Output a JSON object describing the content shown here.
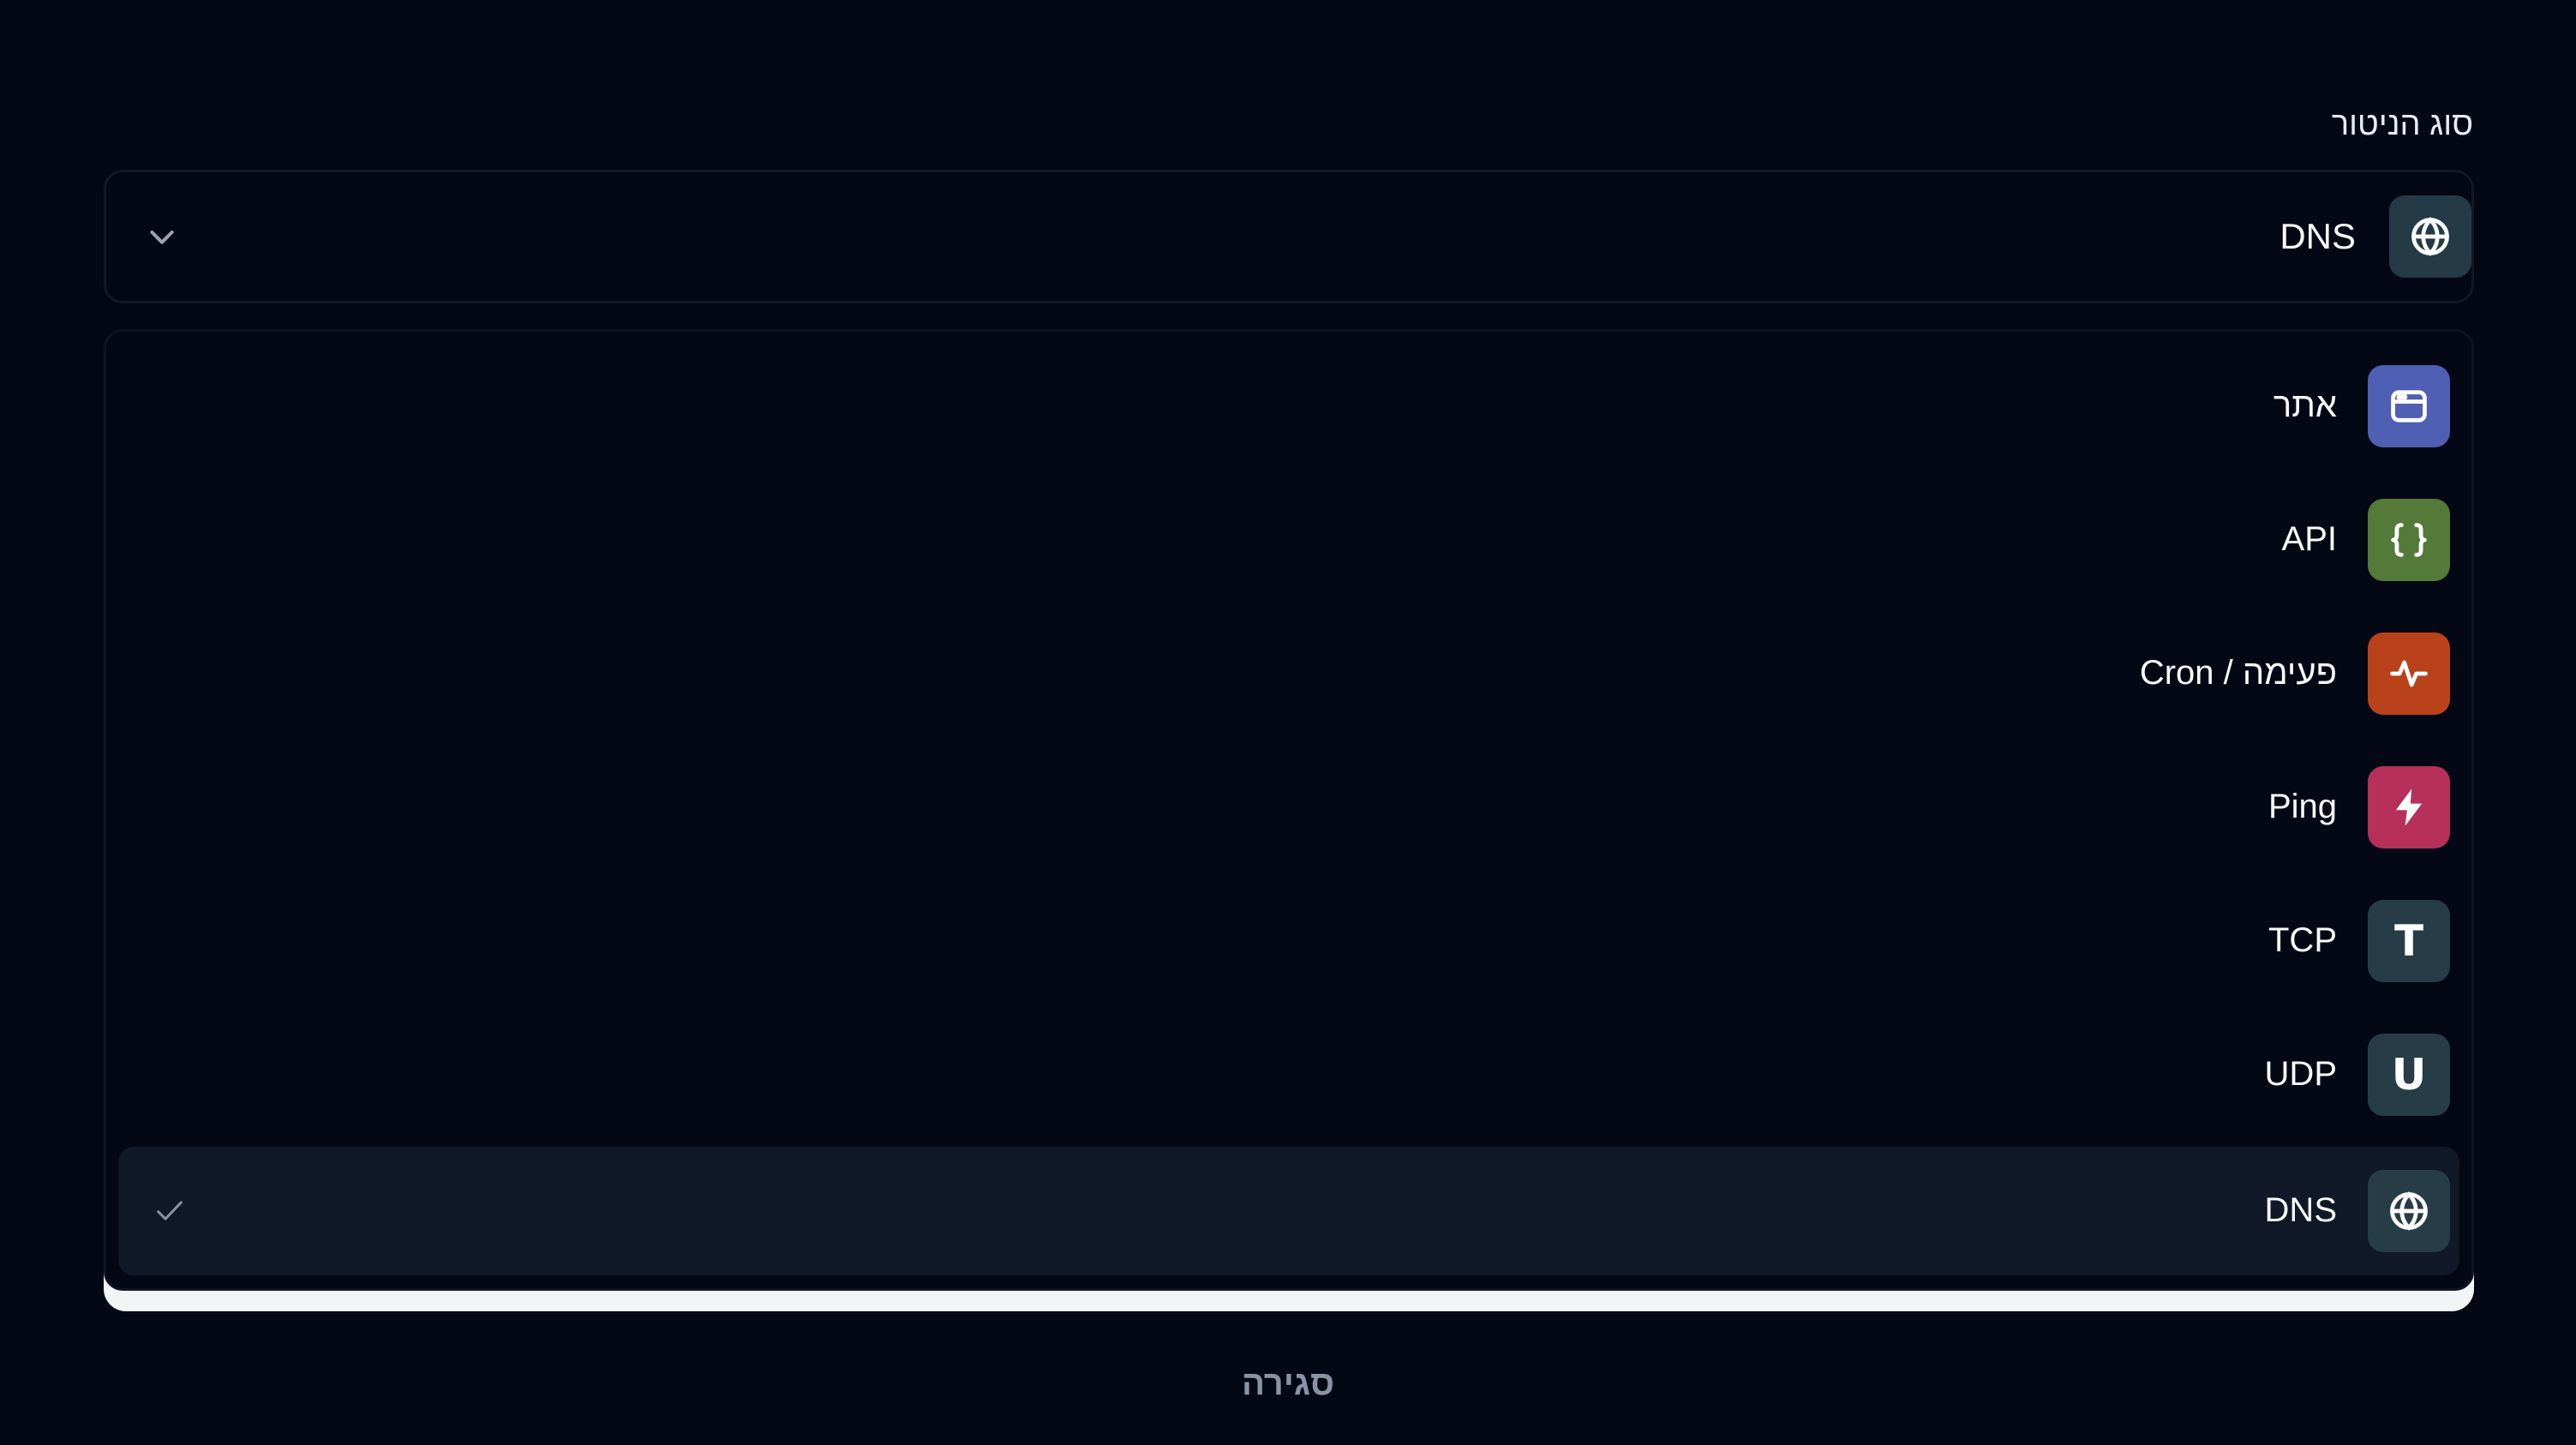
{
  "field_label": "סוג הניטור",
  "select": {
    "value": "DNS",
    "icon": "globe-icon",
    "icon_bg": "#243a47"
  },
  "options": [
    {
      "label": "אתר",
      "icon": "browser-window-icon",
      "icon_bg": "#4f5fb3"
    },
    {
      "label": "API",
      "icon": "braces-icon",
      "icon_bg": "#547a3a"
    },
    {
      "label": "Cron / פעימה",
      "icon": "heartbeat-icon",
      "icon_bg": "#b9421a"
    },
    {
      "label": "Ping",
      "icon": "lightning-icon",
      "icon_bg": "#b6305a"
    },
    {
      "label": "TCP",
      "icon": "letter-t-icon",
      "icon_bg": "#263d48",
      "letter": "T"
    },
    {
      "label": "UDP",
      "icon": "letter-u-icon",
      "icon_bg": "#263d48",
      "letter": "U"
    },
    {
      "label": "DNS",
      "icon": "globe-icon",
      "icon_bg": "#263d48",
      "selected": true
    }
  ],
  "close_label": "סגירה",
  "colors": {
    "background": "#040814",
    "selected_row": "#111827",
    "muted_text": "#8a93a3"
  }
}
